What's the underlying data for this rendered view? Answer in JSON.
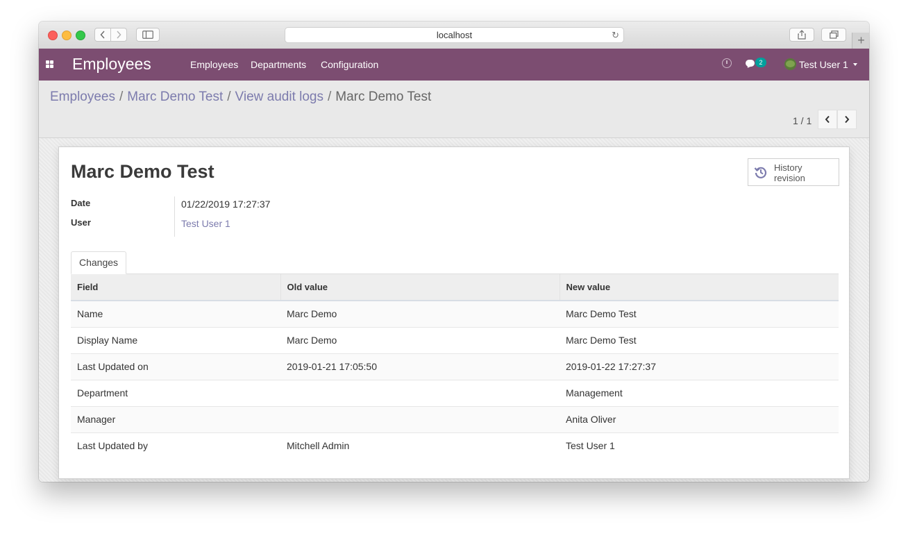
{
  "browser": {
    "address": "localhost"
  },
  "navbar": {
    "app_name": "Employees",
    "menu": [
      "Employees",
      "Departments",
      "Configuration"
    ],
    "chat_count": "2",
    "user": "Test User 1"
  },
  "breadcrumb": {
    "items": [
      "Employees",
      "Marc Demo Test",
      "View audit logs"
    ],
    "current": "Marc Demo Test",
    "separator": "/"
  },
  "pager": {
    "value": "1 / 1"
  },
  "record": {
    "title": "Marc Demo Test",
    "history_button": "History revision",
    "fields": {
      "date_label": "Date",
      "date_value": "01/22/2019 17:27:37",
      "user_label": "User",
      "user_value": "Test User 1"
    }
  },
  "tabs": [
    "Changes"
  ],
  "changes_table": {
    "headers": [
      "Field",
      "Old value",
      "New value"
    ],
    "rows": [
      [
        "Name",
        "Marc Demo",
        "Marc Demo Test"
      ],
      [
        "Display Name",
        "Marc Demo",
        "Marc Demo Test"
      ],
      [
        "Last Updated on",
        "2019-01-21 17:05:50",
        "2019-01-22 17:27:37"
      ],
      [
        "Department",
        "",
        "Management"
      ],
      [
        "Manager",
        "",
        "Anita Oliver"
      ],
      [
        "Last Updated by",
        "Mitchell Admin",
        "Test User 1"
      ]
    ]
  },
  "colors": {
    "navbar": "#7c4d71",
    "link": "#7c7bad",
    "badge": "#00a09d"
  }
}
